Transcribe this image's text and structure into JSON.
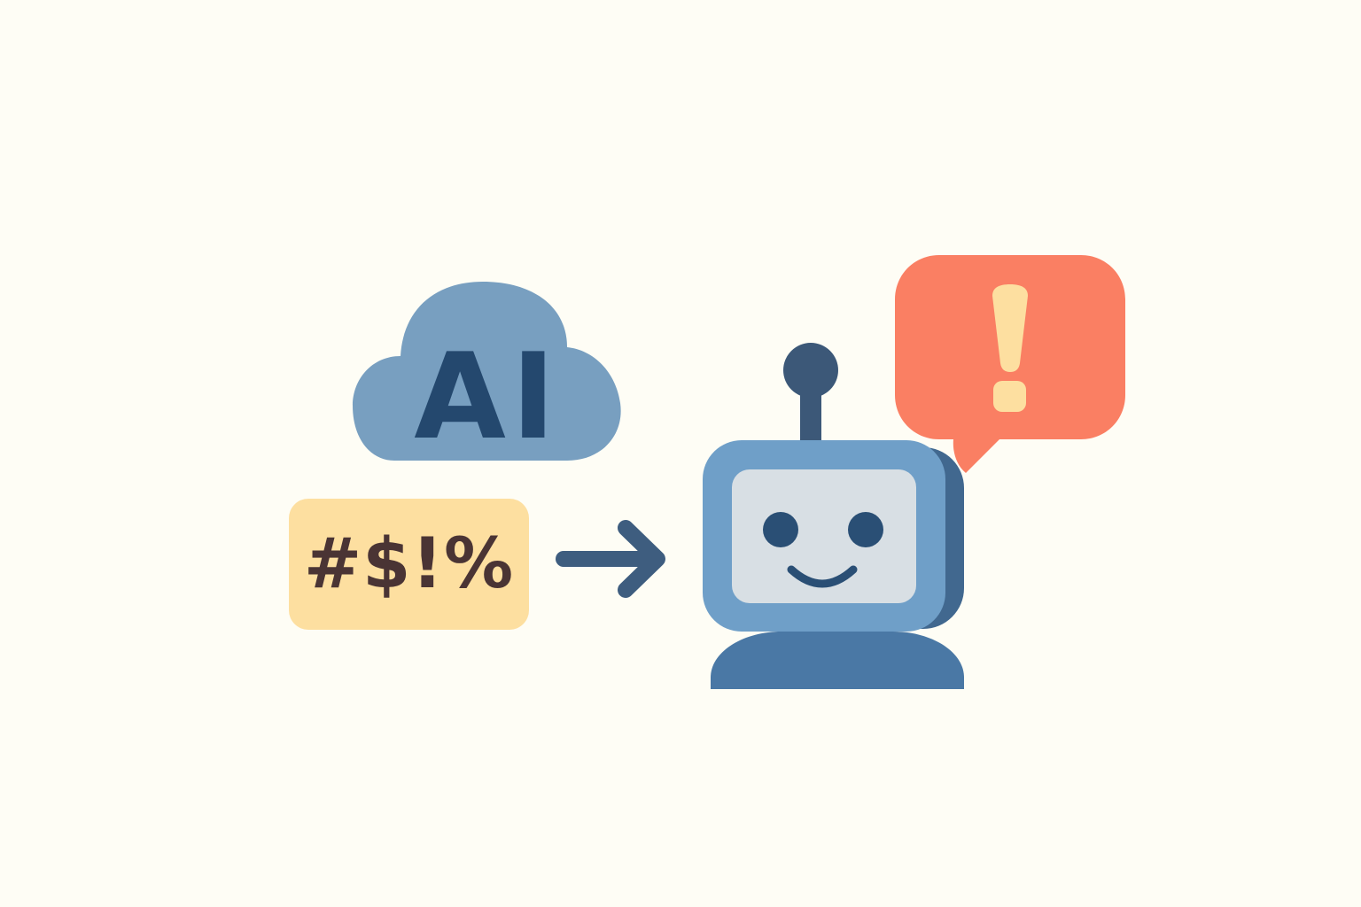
{
  "cloud": {
    "label": "AI",
    "color": "#789FC0",
    "text_color": "#24486E"
  },
  "input_box": {
    "text": "#$!%",
    "background": "#FDDFA0",
    "text_color": "#4A3434"
  },
  "arrow": {
    "icon": "arrow-right-icon",
    "color": "#3E5D7F"
  },
  "robot": {
    "icon": "robot-icon",
    "head_color": "#6F9FC8",
    "head_shadow_color": "#41688F",
    "screen_color": "#D8DFE4",
    "feature_color": "#2A4F75",
    "body_color": "#4A78A5",
    "antenna_color": "#3C5878"
  },
  "alert_bubble": {
    "icon": "exclamation-icon",
    "background": "#FA7F63",
    "mark_color": "#FDDFA0"
  },
  "colors": {
    "background": "#FEFDF5"
  }
}
